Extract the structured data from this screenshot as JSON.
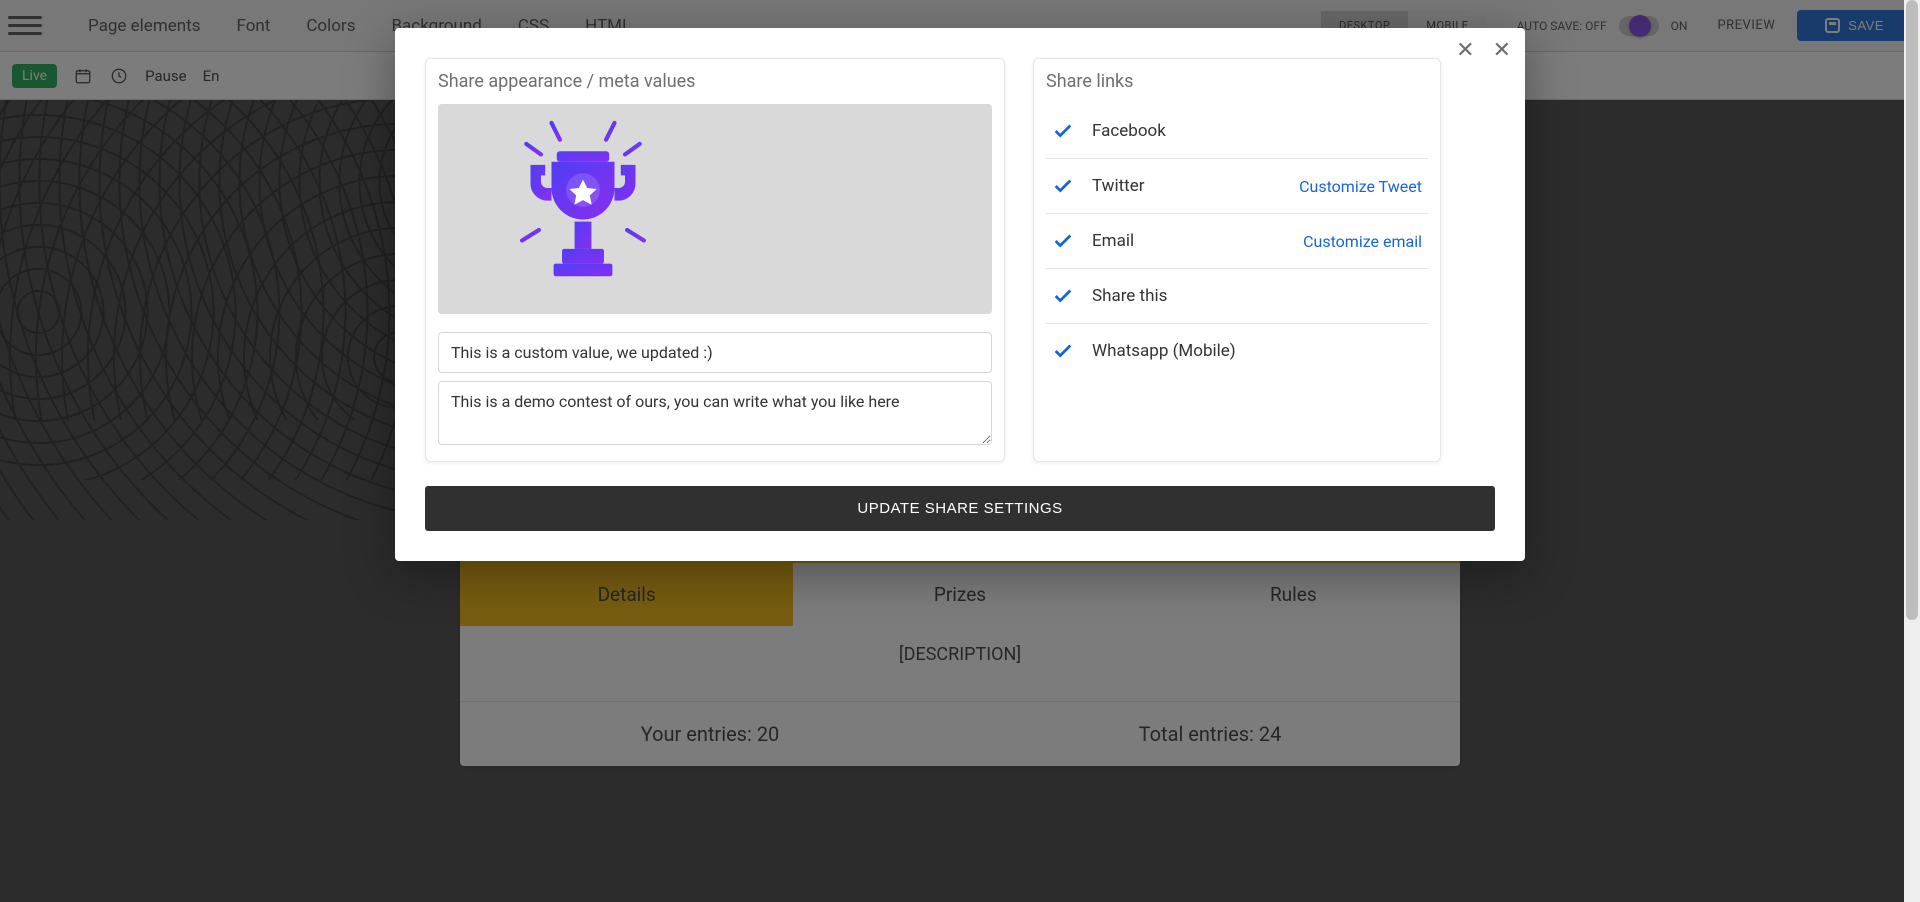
{
  "topbar": {
    "items": [
      "Page elements",
      "Font",
      "Colors",
      "Background",
      "CSS",
      "HTML"
    ],
    "device": {
      "desktop": "DESKTOP",
      "mobile": "MOBILE",
      "active": "desktop"
    },
    "autosave": {
      "off_label": "AUTO SAVE: OFF",
      "on_label": "ON"
    },
    "preview": "PREVIEW",
    "save": "SAVE"
  },
  "statusbar": {
    "live": "Live",
    "pause": "Pause",
    "en": "En"
  },
  "content": {
    "tabs": {
      "details": "Details",
      "prizes": "Prizes",
      "rules": "Rules"
    },
    "description": "[DESCRIPTION]",
    "your_entries_label": "Your entries:",
    "your_entries_value": "20",
    "total_entries_label": "Total entries:",
    "total_entries_value": "24"
  },
  "modal": {
    "left_title": "Share appearance / meta values",
    "title_value": "This is a custom value, we updated :)",
    "desc_value": "This is a demo contest of ours, you can write what you like here",
    "right_title": "Share links",
    "items": [
      {
        "label": "Facebook",
        "action": ""
      },
      {
        "label": "Twitter",
        "action": "Customize Tweet"
      },
      {
        "label": "Email",
        "action": "Customize email"
      },
      {
        "label": "Share this",
        "action": ""
      },
      {
        "label": "Whatsapp (Mobile)",
        "action": ""
      }
    ],
    "update": "UPDATE SHARE SETTINGS"
  }
}
